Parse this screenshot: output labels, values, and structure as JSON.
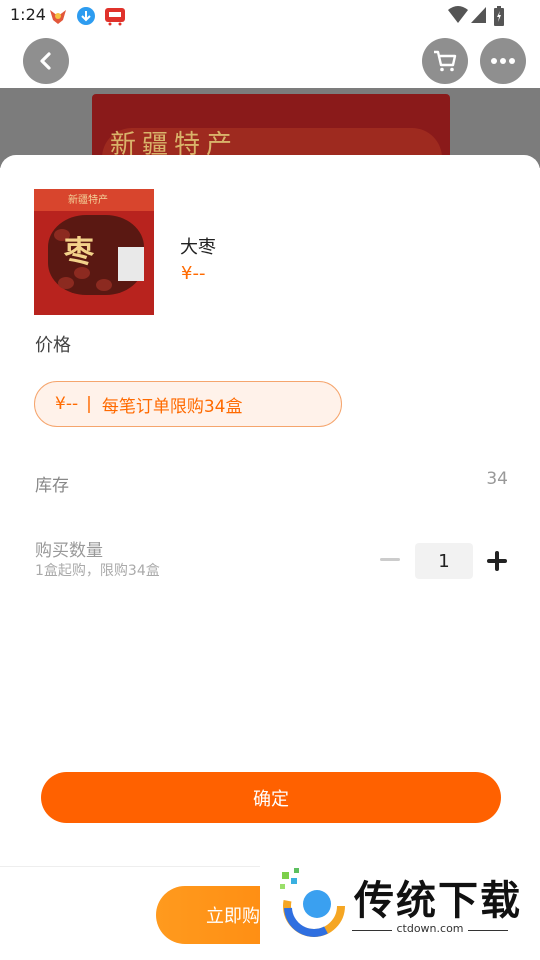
{
  "status_bar": {
    "time": "1:24"
  },
  "product": {
    "name": "大枣",
    "price": "¥--"
  },
  "sections": {
    "price_label": "价格",
    "spec_option": {
      "price": "¥--",
      "separator": "|",
      "limit_text": "每笔订单限购34盒"
    },
    "stock_label": "库存",
    "stock_value": "34",
    "quantity_label": "购买数量",
    "quantity_hint": "1盒起购，限购34盒",
    "quantity_value": "1"
  },
  "confirm_label": "确定",
  "buy_now_label": "立即购",
  "watermark": {
    "text": "传统下载",
    "url": "ctdown.com"
  },
  "colors": {
    "accent": "#ff6100",
    "accent_light": "#fff2ea"
  }
}
